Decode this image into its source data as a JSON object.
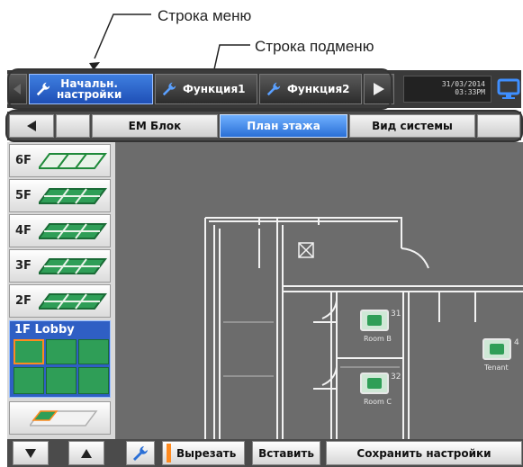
{
  "annotations": {
    "menu_bar": "Строка меню",
    "submenu_bar": "Строка подменю"
  },
  "menu": {
    "tabs": [
      {
        "label": "Начальн.\nнастройки",
        "active": true
      },
      {
        "label": "Функция1",
        "active": false
      },
      {
        "label": "Функция2",
        "active": false
      }
    ],
    "datetime": {
      "date": "31/03/2014",
      "time": "03:33PM"
    }
  },
  "submenu": {
    "tabs": [
      {
        "label": "EM Блок",
        "active": false
      },
      {
        "label": "План этажа",
        "active": true
      },
      {
        "label": "Вид системы",
        "active": false
      }
    ]
  },
  "floors": {
    "items": [
      "6F",
      "5F",
      "4F",
      "3F",
      "2F"
    ],
    "selected": "1F Lobby"
  },
  "floorplan": {
    "units": [
      {
        "number": "31",
        "room": "Room B"
      },
      {
        "number": "32",
        "room": "Room C"
      },
      {
        "number": "4",
        "room": "Tenant"
      }
    ]
  },
  "toolbar": {
    "cut_label": "Вырезать",
    "paste_label": "Вставить",
    "save_label": "Сохранить настройки"
  },
  "colors": {
    "accent_blue": "#2a6fd6",
    "selected_floor": "#2f5fc4",
    "unit_green": "#2f9e57",
    "canvas_bg": "#6c6c6c"
  }
}
